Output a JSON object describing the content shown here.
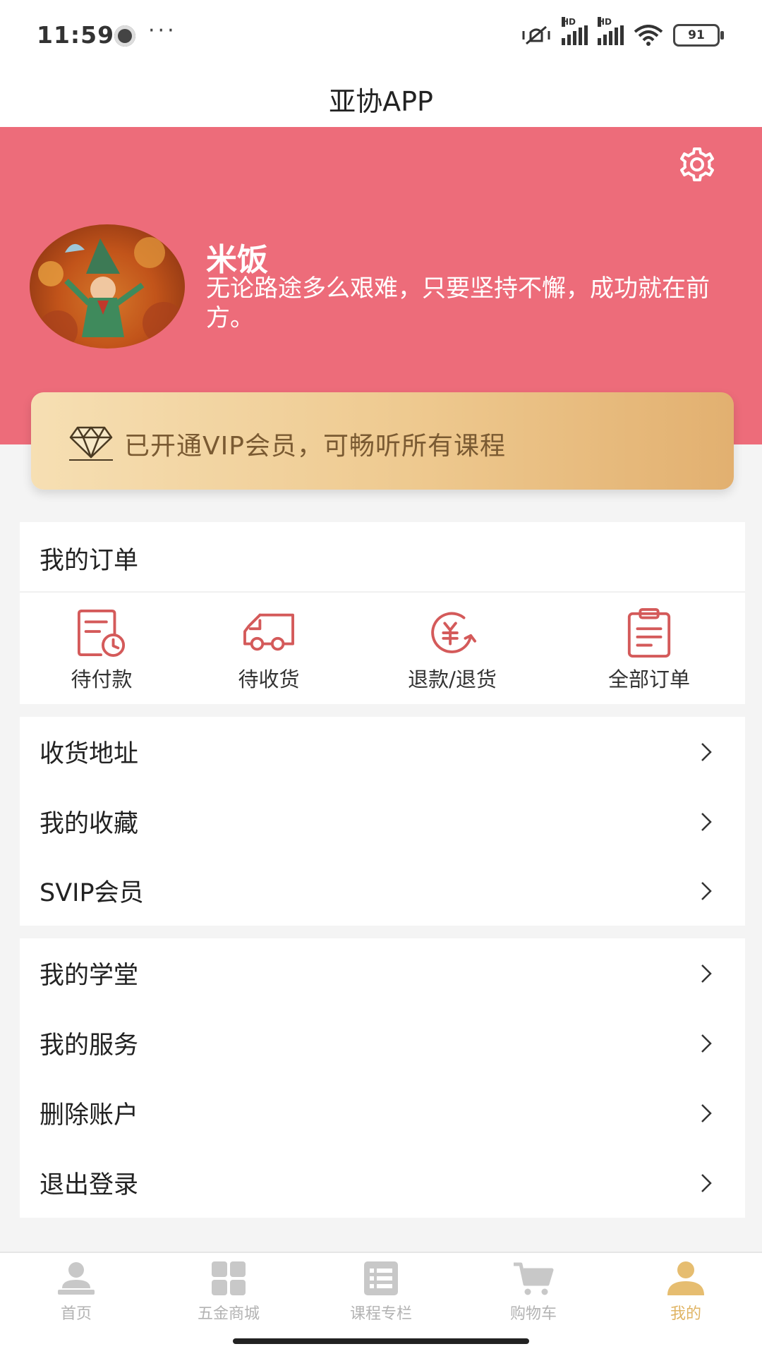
{
  "status_bar": {
    "time": "11:59",
    "more": "···",
    "battery": "91"
  },
  "header": {
    "title": "亚协APP"
  },
  "profile": {
    "name": "米饭",
    "motto": "无论路途多么艰难，只要坚持不懈，成功就在前方。",
    "banner_color": "#ed6c7a"
  },
  "vip": {
    "text": "已开通VIP会员，可畅听所有课程"
  },
  "orders": {
    "title": "我的订单",
    "items": [
      {
        "label": "待付款",
        "icon": "pending-payment-icon"
      },
      {
        "label": "待收货",
        "icon": "delivery-truck-icon"
      },
      {
        "label": "退款/退货",
        "icon": "refund-icon"
      },
      {
        "label": "全部订单",
        "icon": "clipboard-icon"
      }
    ]
  },
  "menu_group_1": [
    {
      "label": "收货地址"
    },
    {
      "label": "我的收藏"
    },
    {
      "label": "SVIP会员"
    }
  ],
  "menu_group_2": [
    {
      "label": "我的学堂"
    },
    {
      "label": "我的服务"
    },
    {
      "label": "删除账户"
    },
    {
      "label": "退出登录"
    }
  ],
  "bottom_nav": {
    "items": [
      {
        "label": "首页",
        "icon": "home-person-icon"
      },
      {
        "label": "五金商城",
        "icon": "grid-icon"
      },
      {
        "label": "课程专栏",
        "icon": "list-icon"
      },
      {
        "label": "购物车",
        "icon": "cart-icon"
      },
      {
        "label": "我的",
        "icon": "profile-icon"
      }
    ],
    "active_index": 4,
    "active_color": "#e0b464",
    "inactive_color": "#b3b3b3"
  }
}
